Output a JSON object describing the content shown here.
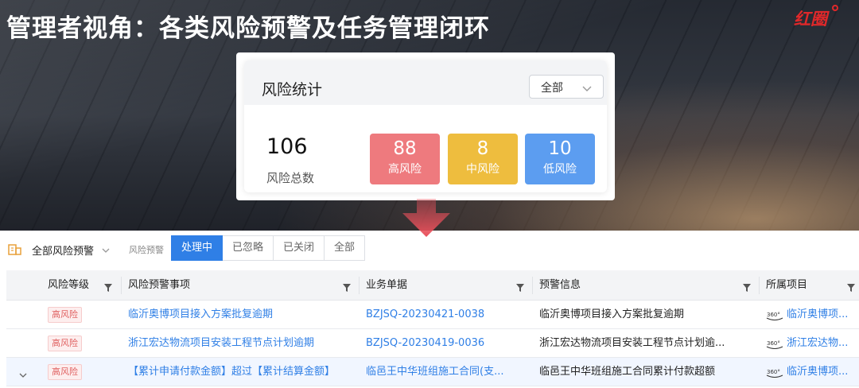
{
  "headline": "管理者视角：各类风险预警及任务管理闭环",
  "logo_text": "红圈",
  "stats_card": {
    "title": "风险统计",
    "filter_value": "全部",
    "total": "106",
    "total_label": "风险总数",
    "tiles": [
      {
        "value": "88",
        "label": "高风险",
        "color": "#ee7a7e"
      },
      {
        "value": "8",
        "label": "中风险",
        "color": "#eebd3e"
      },
      {
        "value": "10",
        "label": "低风险",
        "color": "#5c9df0"
      }
    ]
  },
  "toolbar": {
    "dropdown_label": "全部风险预警",
    "segment_label": "风险预警",
    "segments": [
      "处理中",
      "已忽略",
      "已关闭",
      "全部"
    ],
    "active_segment": "处理中"
  },
  "table": {
    "columns": [
      "风险等级",
      "风险预警事项",
      "业务单据",
      "预警信息",
      "所属项目"
    ],
    "rows": [
      {
        "level": "高风险",
        "item": "临沂奥博项目接入方案批复逾期",
        "doc": "BZJSQ-20230421-0038",
        "info": "临沂奥博项目接入方案批复逾期",
        "project": "临沂奥博项..."
      },
      {
        "level": "高风险",
        "item": "浙江宏达物流项目安装工程节点计划逾期",
        "doc": "BZJSQ-20230419-0036",
        "info": "浙江宏达物流项目安装工程节点计划逾...",
        "project": "浙江宏达物..."
      },
      {
        "level": "高风险",
        "item": "【累计申请付款金额】超过【累计结算金额】",
        "doc": "临邑王中华班组施工合同(支...",
        "info": "临邑王中华班组施工合同累计付款超额",
        "project": "临沂奥博项..."
      }
    ]
  },
  "colors": {
    "primary": "#2f7fe6",
    "high": "#ee7a7e",
    "mid": "#eebd3e",
    "low": "#5c9df0",
    "arrow": "#e8505b"
  }
}
